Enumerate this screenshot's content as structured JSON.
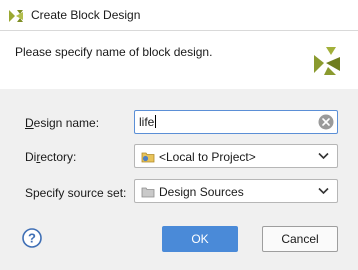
{
  "window": {
    "title": "Create Block Design"
  },
  "header": {
    "text": "Please specify name of block design."
  },
  "form": {
    "design_name": {
      "label_u": "D",
      "label_rest": "esign name:",
      "value": "life"
    },
    "directory": {
      "label_pre": "Di",
      "label_u": "r",
      "label_rest": "ectory:",
      "value": "<Local to Project>"
    },
    "source_set": {
      "label": "Specify source set:",
      "value": "Design Sources"
    }
  },
  "buttons": {
    "ok": "OK",
    "cancel": "Cancel"
  },
  "colors": {
    "primary_button": "#4a8ad8",
    "logo": "#8a9a2e",
    "focus_border": "#5b8fd6"
  },
  "icons": {
    "title": "block-design-icon",
    "logo": "vivado-logo-icon",
    "clear": "clear-icon",
    "help": "help-icon"
  }
}
